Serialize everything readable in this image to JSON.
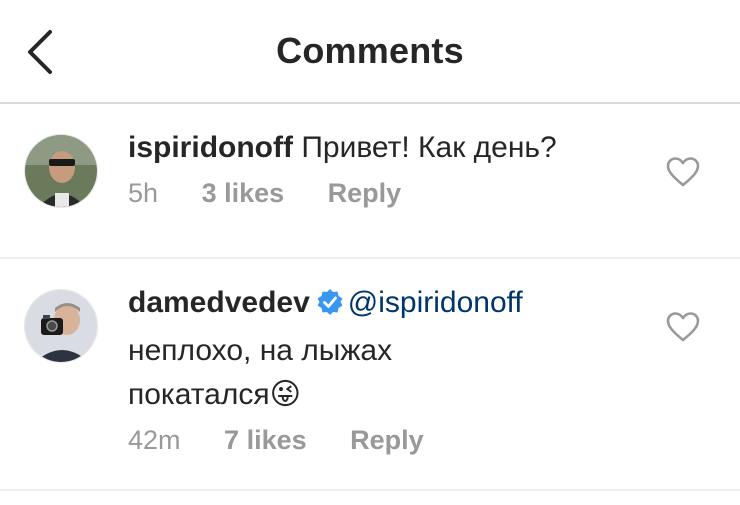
{
  "header": {
    "title": "Comments",
    "back_icon": "chevron-left-icon"
  },
  "comments": [
    {
      "username": "ispiridonoff",
      "text": "Привет! Как день?",
      "time": "5h",
      "likes": "3 likes",
      "reply": "Reply",
      "verified": false,
      "like_icon": "heart-outline-icon"
    },
    {
      "username": "damedvedev",
      "mention": "@ispiridonoff",
      "text_line1": "неплохо, на лыжах",
      "text_line2": "покатался",
      "emoji": "😜",
      "time": "42m",
      "likes": "7 likes",
      "reply": "Reply",
      "verified": true,
      "like_icon": "heart-outline-icon"
    }
  ],
  "colors": {
    "text": "#262626",
    "meta": "#999999",
    "mention": "#003569",
    "verified": "#3897f0",
    "divider": "#efefef"
  }
}
